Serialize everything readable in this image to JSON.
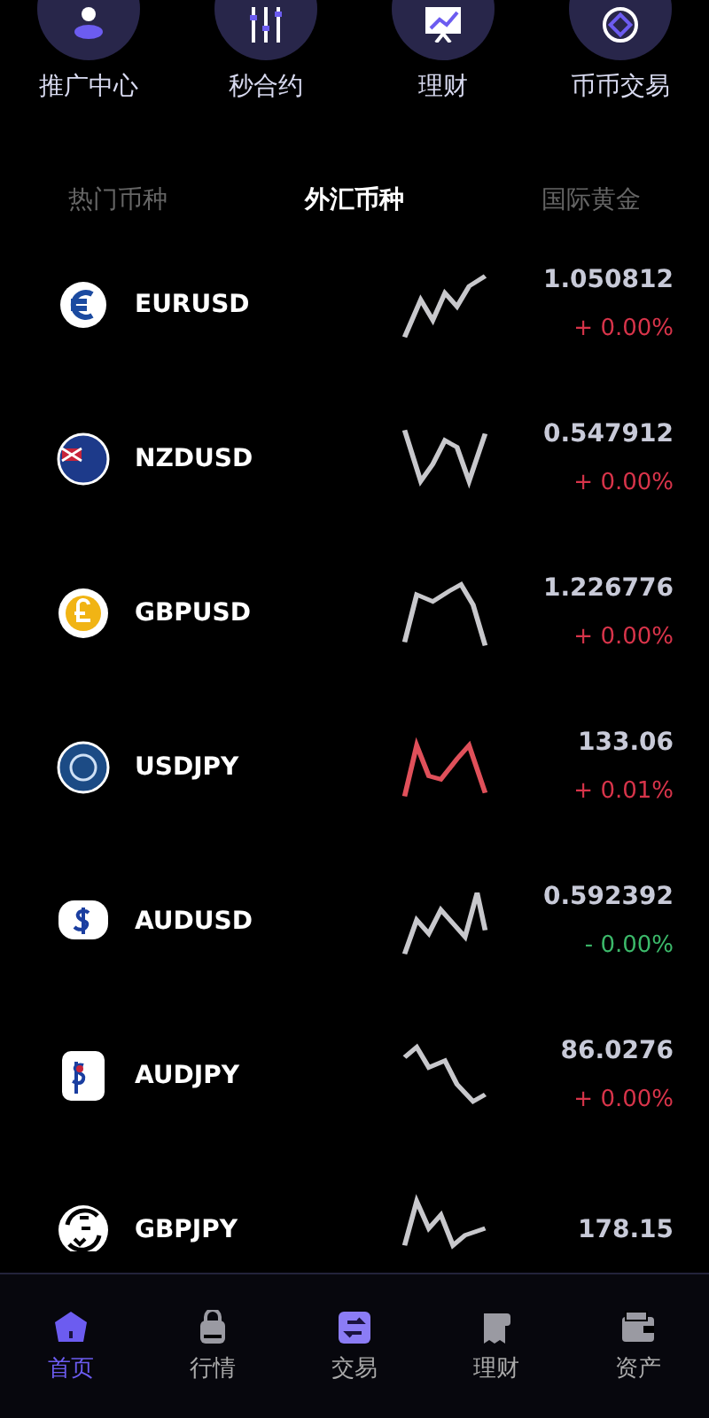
{
  "shortcuts": [
    {
      "label": "推广中心"
    },
    {
      "label": "秒合约"
    },
    {
      "label": "理财"
    },
    {
      "label": "币币交易"
    }
  ],
  "tabs": [
    {
      "label": "热门币种",
      "selected": false
    },
    {
      "label": "外汇币种",
      "selected": true
    },
    {
      "label": "国际黄金",
      "selected": false
    }
  ],
  "rows": [
    {
      "symbol": "EURUSD",
      "price": "1.050812",
      "change": "+ 0.00%",
      "color": "#d8344a",
      "sparkline_highlight": false
    },
    {
      "symbol": "NZDUSD",
      "price": "0.547912",
      "change": "+ 0.00%",
      "color": "#d8344a",
      "sparkline_highlight": false
    },
    {
      "symbol": "GBPUSD",
      "price": "1.226776",
      "change": "+ 0.00%",
      "color": "#d8344a",
      "sparkline_highlight": false
    },
    {
      "symbol": "USDJPY",
      "price": "133.06",
      "change": "+ 0.01%",
      "color": "#d8344a",
      "sparkline_highlight": true
    },
    {
      "symbol": "AUDUSD",
      "price": "0.592392",
      "change": "- 0.00%",
      "color": "#3cb96a",
      "sparkline_highlight": false
    },
    {
      "symbol": "AUDJPY",
      "price": "86.0276",
      "change": "+ 0.00%",
      "color": "#d8344a",
      "sparkline_highlight": false
    },
    {
      "symbol": "GBPJPY",
      "price": "178.15",
      "sparkline_highlight": false
    }
  ],
  "nav": [
    {
      "label": "首页",
      "selected": true
    },
    {
      "label": "行情",
      "selected": false
    },
    {
      "label": "交易",
      "selected": false
    },
    {
      "label": "理财",
      "selected": false
    },
    {
      "label": "资产",
      "selected": false
    }
  ]
}
